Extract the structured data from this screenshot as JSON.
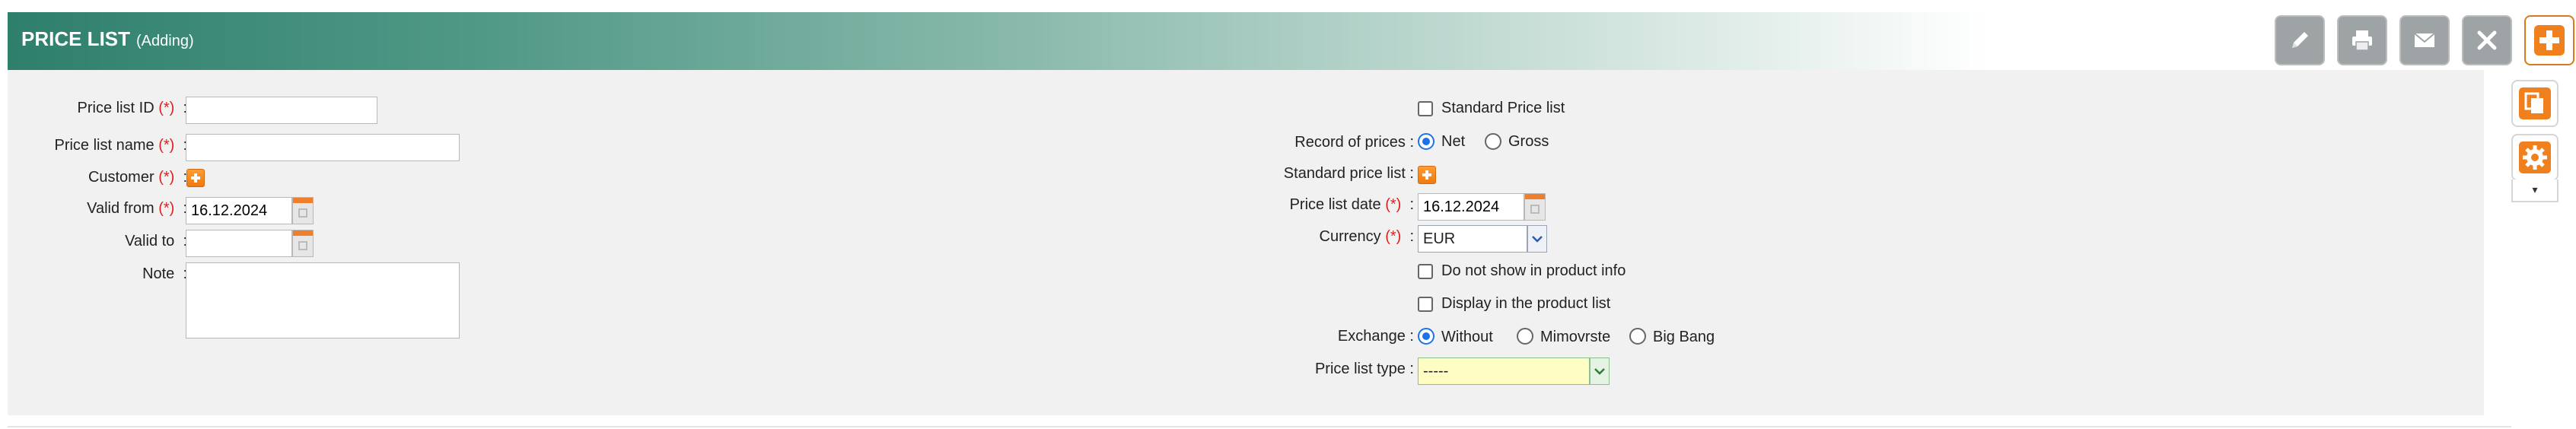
{
  "header": {
    "title": "PRICE LIST",
    "mode": "(Adding)",
    "buttons": [
      {
        "name": "edit-button",
        "icon": "pencil-icon"
      },
      {
        "name": "print-button",
        "icon": "printer-icon"
      },
      {
        "name": "email-button",
        "icon": "envelope-icon"
      },
      {
        "name": "close-button",
        "icon": "close-icon"
      },
      {
        "name": "add-button",
        "icon": "plus-icon"
      }
    ]
  },
  "side": {
    "copy_icon": "copy-icon",
    "settings_icon": "gear-icon",
    "dropdown_arrow": "▾"
  },
  "left": {
    "price_list_id": {
      "label": "Price list ID",
      "req": "(*)",
      "colon": ":",
      "value": ""
    },
    "price_list_name": {
      "label": "Price list name",
      "req": "(*)",
      "colon": ":",
      "value": ""
    },
    "customer": {
      "label": "Customer",
      "req": "(*)",
      "colon": ":"
    },
    "valid_from": {
      "label": "Valid from",
      "req": "(*)",
      "colon": ":",
      "value": "16.12.2024"
    },
    "valid_to": {
      "label": "Valid to",
      "colon": ":",
      "value": ""
    },
    "note": {
      "label": "Note",
      "colon": ":",
      "value": ""
    }
  },
  "right": {
    "standard_price_list_checkbox": "Standard Price list",
    "record_of_prices": {
      "label": "Record of prices :",
      "options": [
        "Net",
        "Gross"
      ],
      "selected": "Net"
    },
    "standard_price_list": {
      "label": "Standard price list :"
    },
    "price_list_date": {
      "label": "Price list date",
      "req": "(*)",
      "colon": ":",
      "value": "16.12.2024"
    },
    "currency": {
      "label": "Currency",
      "req": "(*)",
      "colon": ":",
      "value": "EUR"
    },
    "do_not_show": "Do not show in product info",
    "display_in_list": "Display in the product list",
    "exchange": {
      "label": "Exchange :",
      "options": [
        "Without",
        "Mimovrste",
        "Big Bang"
      ],
      "selected": "Without"
    },
    "price_list_type": {
      "label": "Price list type :",
      "value": "-----"
    }
  },
  "colors": {
    "header_start": "#2f7f6d",
    "required": "#e02020",
    "accent_orange": "#ee7a12",
    "radio_selected": "#1a73e8",
    "type_select_bg": "#fdfdc4"
  }
}
